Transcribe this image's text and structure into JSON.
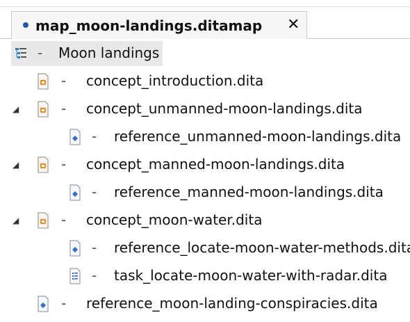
{
  "editor": {
    "tab": {
      "title": "map_moon-landings.ditamap",
      "close_glyph": "✕",
      "modified_indicator_color": "#1f5aa8"
    }
  },
  "tree": {
    "separator": "-",
    "root": {
      "label": "Moon landings",
      "icon": "map-icon"
    },
    "items": [
      {
        "label": "concept_introduction.dita",
        "icon": "concept-icon",
        "level": 1,
        "expanded": null
      },
      {
        "label": "concept_unmanned-moon-landings.dita",
        "icon": "concept-icon",
        "level": 1,
        "expanded": true
      },
      {
        "label": "reference_unmanned-moon-landings.dita",
        "icon": "reference-icon",
        "level": 2,
        "expanded": null
      },
      {
        "label": "concept_manned-moon-landings.dita",
        "icon": "concept-icon",
        "level": 1,
        "expanded": true
      },
      {
        "label": "reference_manned-moon-landings.dita",
        "icon": "reference-icon",
        "level": 2,
        "expanded": null
      },
      {
        "label": "concept_moon-water.dita",
        "icon": "concept-icon",
        "level": 1,
        "expanded": true
      },
      {
        "label": "reference_locate-moon-water-methods.dita",
        "icon": "reference-icon",
        "level": 2,
        "expanded": null
      },
      {
        "label": "task_locate-moon-water-with-radar.dita",
        "icon": "task-icon",
        "level": 2,
        "expanded": null
      },
      {
        "label": "reference_moon-landing-conspiracies.dita",
        "icon": "reference-icon",
        "level": 1,
        "expanded": null
      }
    ]
  },
  "colors": {
    "concept_orange": "#f28c28",
    "reference_blue": "#2f6fc4",
    "task_blue": "#2a5ea8",
    "selection_gray": "#e8e8e8"
  }
}
